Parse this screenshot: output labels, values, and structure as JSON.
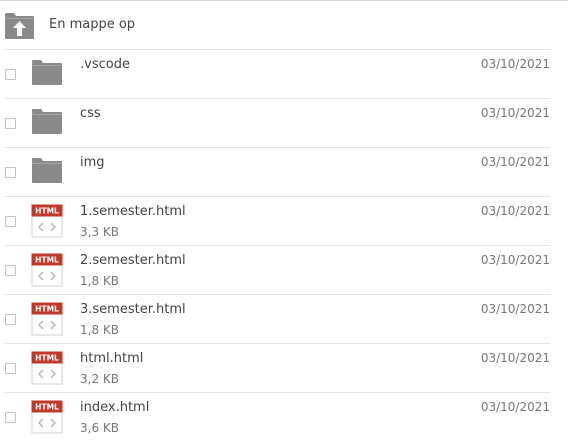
{
  "parent_link": {
    "label": "En mappe op",
    "icon": "folder-up-icon"
  },
  "colors": {
    "folder": "#8a8a8a",
    "html_badge": "#c0392b",
    "text": "#444444",
    "meta": "#777777"
  },
  "entries": [
    {
      "type": "folder",
      "name": ".vscode",
      "size": "",
      "date": "03/10/2021",
      "icon": "folder-icon"
    },
    {
      "type": "folder",
      "name": "css",
      "size": "",
      "date": "03/10/2021",
      "icon": "folder-icon"
    },
    {
      "type": "folder",
      "name": "img",
      "size": "",
      "date": "03/10/2021",
      "icon": "folder-icon"
    },
    {
      "type": "html",
      "name": "1.semester.html",
      "size": "3,3 KB",
      "date": "03/10/2021",
      "icon": "html-file-icon",
      "badge": "HTML"
    },
    {
      "type": "html",
      "name": "2.semester.html",
      "size": "1,8 KB",
      "date": "03/10/2021",
      "icon": "html-file-icon",
      "badge": "HTML"
    },
    {
      "type": "html",
      "name": "3.semester.html",
      "size": "1,8 KB",
      "date": "03/10/2021",
      "icon": "html-file-icon",
      "badge": "HTML"
    },
    {
      "type": "html",
      "name": "html.html",
      "size": "3,2 KB",
      "date": "03/10/2021",
      "icon": "html-file-icon",
      "badge": "HTML"
    },
    {
      "type": "html",
      "name": "index.html",
      "size": "3,6 KB",
      "date": "03/10/2021",
      "icon": "html-file-icon",
      "badge": "HTML"
    }
  ]
}
